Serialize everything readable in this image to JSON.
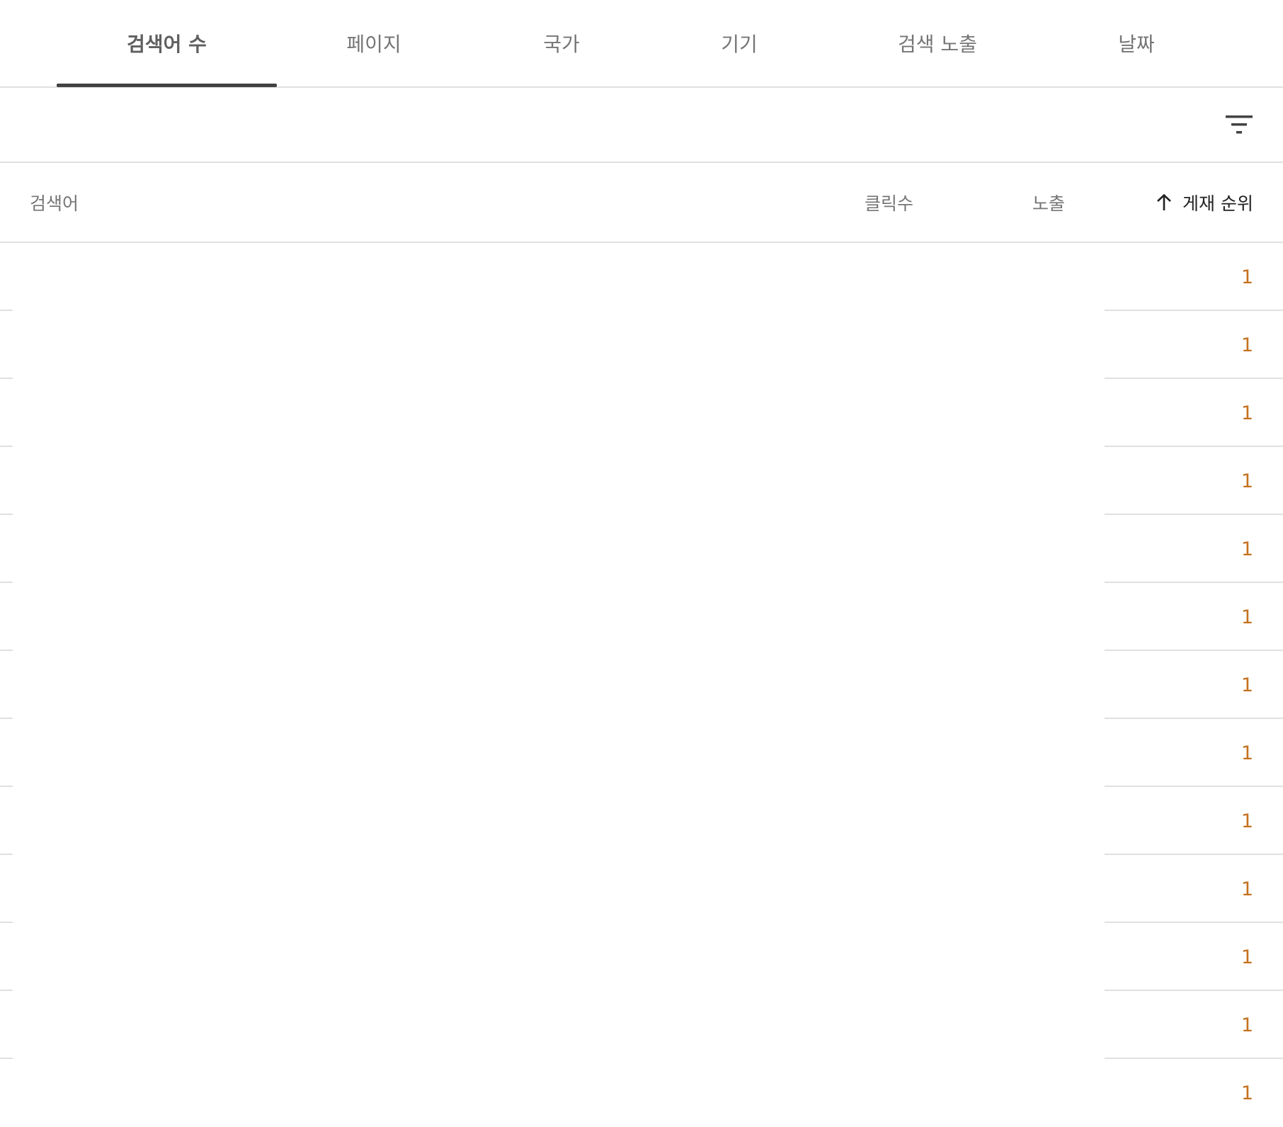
{
  "tabs": [
    {
      "label": "검색어 수",
      "active": true
    },
    {
      "label": "페이지",
      "active": false
    },
    {
      "label": "국가",
      "active": false
    },
    {
      "label": "기기",
      "active": false
    },
    {
      "label": "검색 노출",
      "active": false
    },
    {
      "label": "날짜",
      "active": false
    }
  ],
  "toolbar": {
    "filter_icon": "filter-icon"
  },
  "table": {
    "columns": {
      "query": "검색어",
      "clicks": "클릭수",
      "impressions": "노출",
      "position": "게재 순위"
    },
    "sort_icon": "arrow-up-icon",
    "rows": [
      {
        "query": "",
        "position": "1"
      },
      {
        "query": "",
        "position": "1"
      },
      {
        "query": "",
        "position": "1"
      },
      {
        "query": "",
        "position": "1"
      },
      {
        "query": "",
        "position": "1"
      },
      {
        "query": "",
        "position": "1"
      },
      {
        "query": "",
        "position": "1"
      },
      {
        "query": "",
        "position": "1"
      },
      {
        "query": "",
        "position": "1"
      },
      {
        "query": "",
        "position": "1"
      },
      {
        "query": "",
        "position": "1"
      },
      {
        "query": "",
        "position": "1"
      },
      {
        "query": "",
        "position": "1"
      }
    ]
  },
  "colors": {
    "position_value": "#c5721e",
    "active_indicator": "#424242",
    "divider": "#e0e0e0"
  }
}
